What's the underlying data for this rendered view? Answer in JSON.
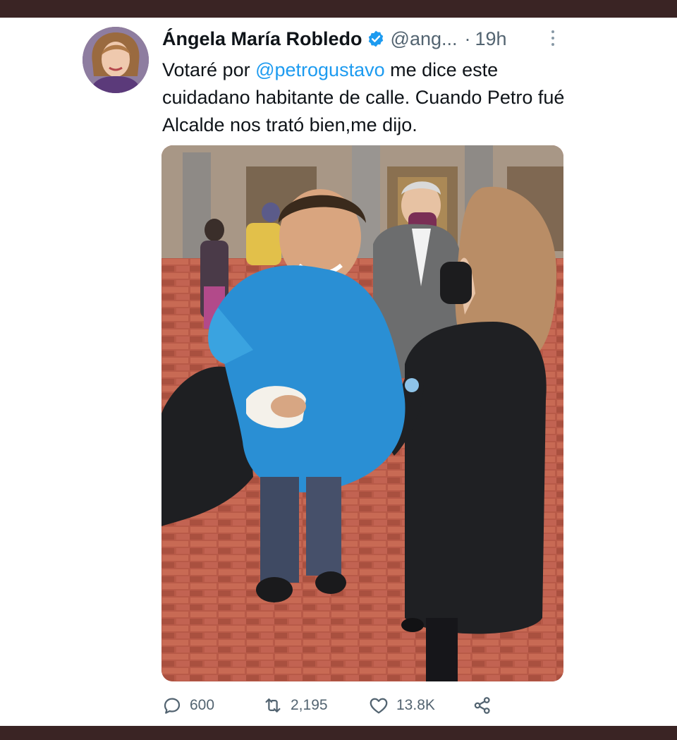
{
  "tweet": {
    "author_name": "Ángela María Robledo",
    "handle": "@ang...",
    "separator": "·",
    "time": "19h",
    "text_before": "Votaré por ",
    "mention": "@petrogustavo",
    "text_after": " me dice este cuidadano habitante de calle. Cuando Petro fué Alcalde nos trató bien,me dijo."
  },
  "icons": {
    "verified": "verified-badge-icon",
    "more": "more-options-icon",
    "reply": "reply-icon",
    "retweet": "retweet-icon",
    "like": "like-icon",
    "share": "share-icon"
  },
  "stats": {
    "replies": "600",
    "retweets": "2,195",
    "likes": "13.8K"
  },
  "colors": {
    "accent": "#1d9bf0",
    "muted": "#536471",
    "frame": "#3a2424"
  }
}
